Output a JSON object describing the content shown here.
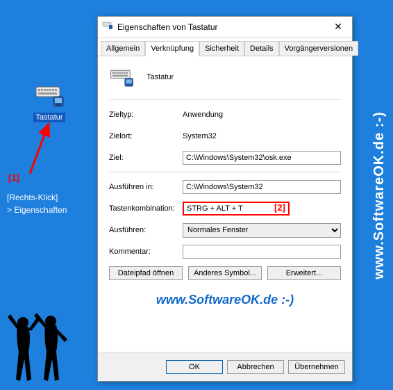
{
  "desktop": {
    "icon_label": "Tastatur"
  },
  "annotations": {
    "marker1": "[1]",
    "rclick": "[Rechts-Klick]",
    "properties": "> Eigenschaften",
    "marker2": "[2]"
  },
  "watermark_vertical": "www.SoftwareOK.de :-)",
  "watermark_inline": "www.SoftwareOK.de :-)",
  "dialog": {
    "title": "Eigenschaften von Tastatur",
    "tabs": {
      "t0": "Allgemein",
      "t1": "Verknüpfung",
      "t2": "Sicherheit",
      "t3": "Details",
      "t4": "Vorgängerversionen"
    },
    "header_label": "Tastatur",
    "fields": {
      "zieltyp_label": "Zieltyp:",
      "zieltyp_value": "Anwendung",
      "zielort_label": "Zielort:",
      "zielort_value": "System32",
      "ziel_label": "Ziel:",
      "ziel_value": "C:\\Windows\\System32\\osk.exe",
      "ausfuehren_in_label": "Ausführen in:",
      "ausfuehren_in_value": "C:\\Windows\\System32",
      "tasten_label": "Tastenkombination:",
      "tasten_value": "STRG + ALT + T",
      "ausfuehren_label": "Ausführen:",
      "ausfuehren_value": "Normales Fenster",
      "kommentar_label": "Kommentar:",
      "kommentar_value": ""
    },
    "buttons": {
      "dateipfad": "Dateipfad öffnen",
      "symbol": "Anderes Symbol...",
      "erweitert": "Erweitert...",
      "ok": "OK",
      "abbrechen": "Abbrechen",
      "uebernehmen": "Übernehmen"
    }
  }
}
